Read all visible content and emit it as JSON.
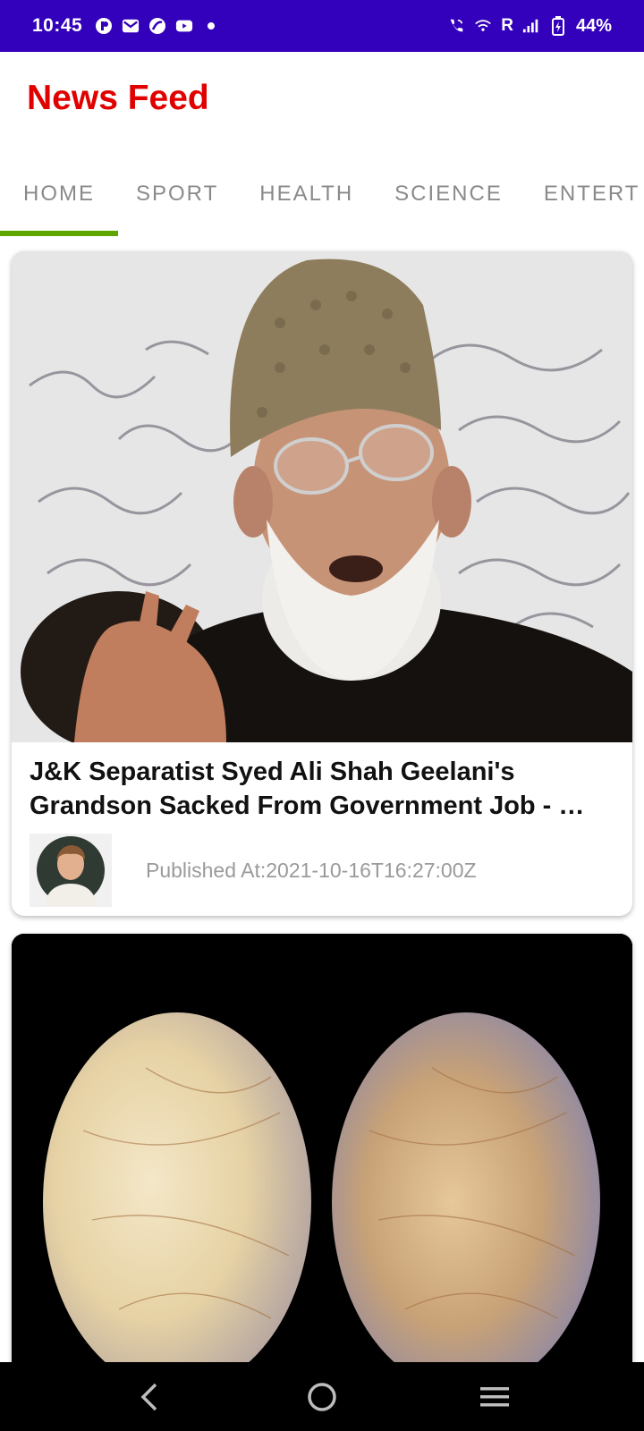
{
  "status_bar": {
    "time": "10:45",
    "carrier": "R",
    "battery": "44%",
    "icons": [
      "app-notification-icon",
      "gmail-icon",
      "cleaner-icon",
      "youtube-icon",
      "dot-icon",
      "wifi-calling-icon",
      "wifi-icon",
      "signal-icon",
      "battery-icon"
    ]
  },
  "app": {
    "title": "News Feed",
    "title_color": "#e00000",
    "status_bar_color": "#3300bb",
    "tab_indicator_color": "#5ea500"
  },
  "tabs": [
    {
      "label": "HOME",
      "selected": true
    },
    {
      "label": "SPORT",
      "selected": false
    },
    {
      "label": "HEALTH",
      "selected": false
    },
    {
      "label": "SCIENCE",
      "selected": false
    },
    {
      "label": "ENTERT",
      "selected": false
    }
  ],
  "articles": [
    {
      "headline": "J&K Separatist Syed Ali Shah Geelani's Grandson Sacked From Government Job - …",
      "published_label": "Published At:",
      "published_at": "2021-10-16T16:27:00Z",
      "image_icon": "news-photo-portrait"
    },
    {
      "image_icon": "news-photo-eggs"
    }
  ],
  "nav_bar": {
    "icons": [
      "back-icon",
      "home-icon",
      "recents-icon"
    ]
  }
}
